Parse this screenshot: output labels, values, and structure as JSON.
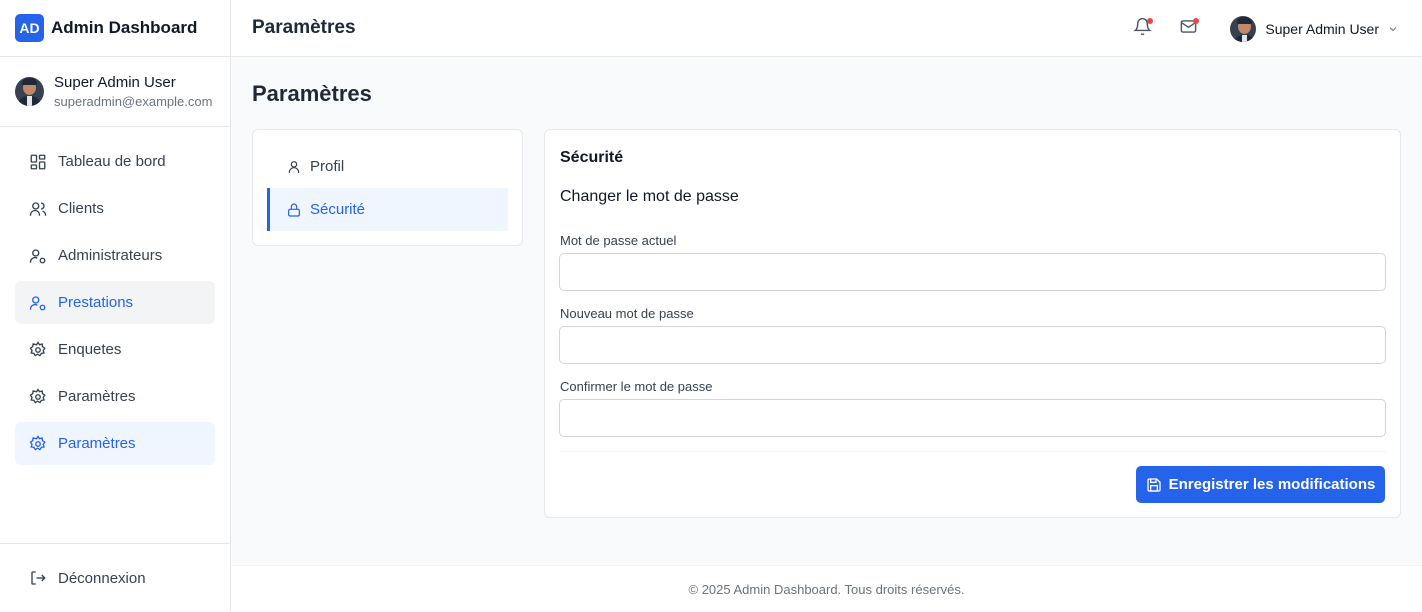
{
  "brand": {
    "badge": "AD",
    "title": "Admin Dashboard"
  },
  "user": {
    "name": "Super Admin User",
    "email": "superadmin@example.com"
  },
  "sidebar": {
    "items": [
      {
        "label": "Tableau de bord",
        "icon": "dashboard-grid-icon"
      },
      {
        "label": "Clients",
        "icon": "users-icon"
      },
      {
        "label": "Administrateurs",
        "icon": "user-cog-icon"
      },
      {
        "label": "Prestations",
        "icon": "user-cog-icon"
      },
      {
        "label": "Enquetes",
        "icon": "gear-icon"
      },
      {
        "label": "Paramètres",
        "icon": "gear-icon"
      },
      {
        "label": "Paramètres",
        "icon": "gear-icon"
      }
    ],
    "logout": "Déconnexion"
  },
  "header": {
    "title": "Paramètres",
    "user_name": "Super Admin User"
  },
  "page": {
    "title": "Paramètres"
  },
  "settings_nav": {
    "profile": "Profil",
    "security": "Sécurité"
  },
  "security": {
    "title": "Sécurité",
    "subtitle": "Changer le mot de passe",
    "current_label": "Mot de passe actuel",
    "current_value": "",
    "new_label": "Nouveau mot de passe",
    "new_value": "",
    "confirm_label": "Confirmer le mot de passe",
    "confirm_value": "",
    "save_label": "Enregistrer les modifications"
  },
  "footer": {
    "text": "© 2025 Admin Dashboard. Tous droits réservés."
  },
  "colors": {
    "accent": "#2563eb",
    "notification_dot": "#ef4444"
  }
}
